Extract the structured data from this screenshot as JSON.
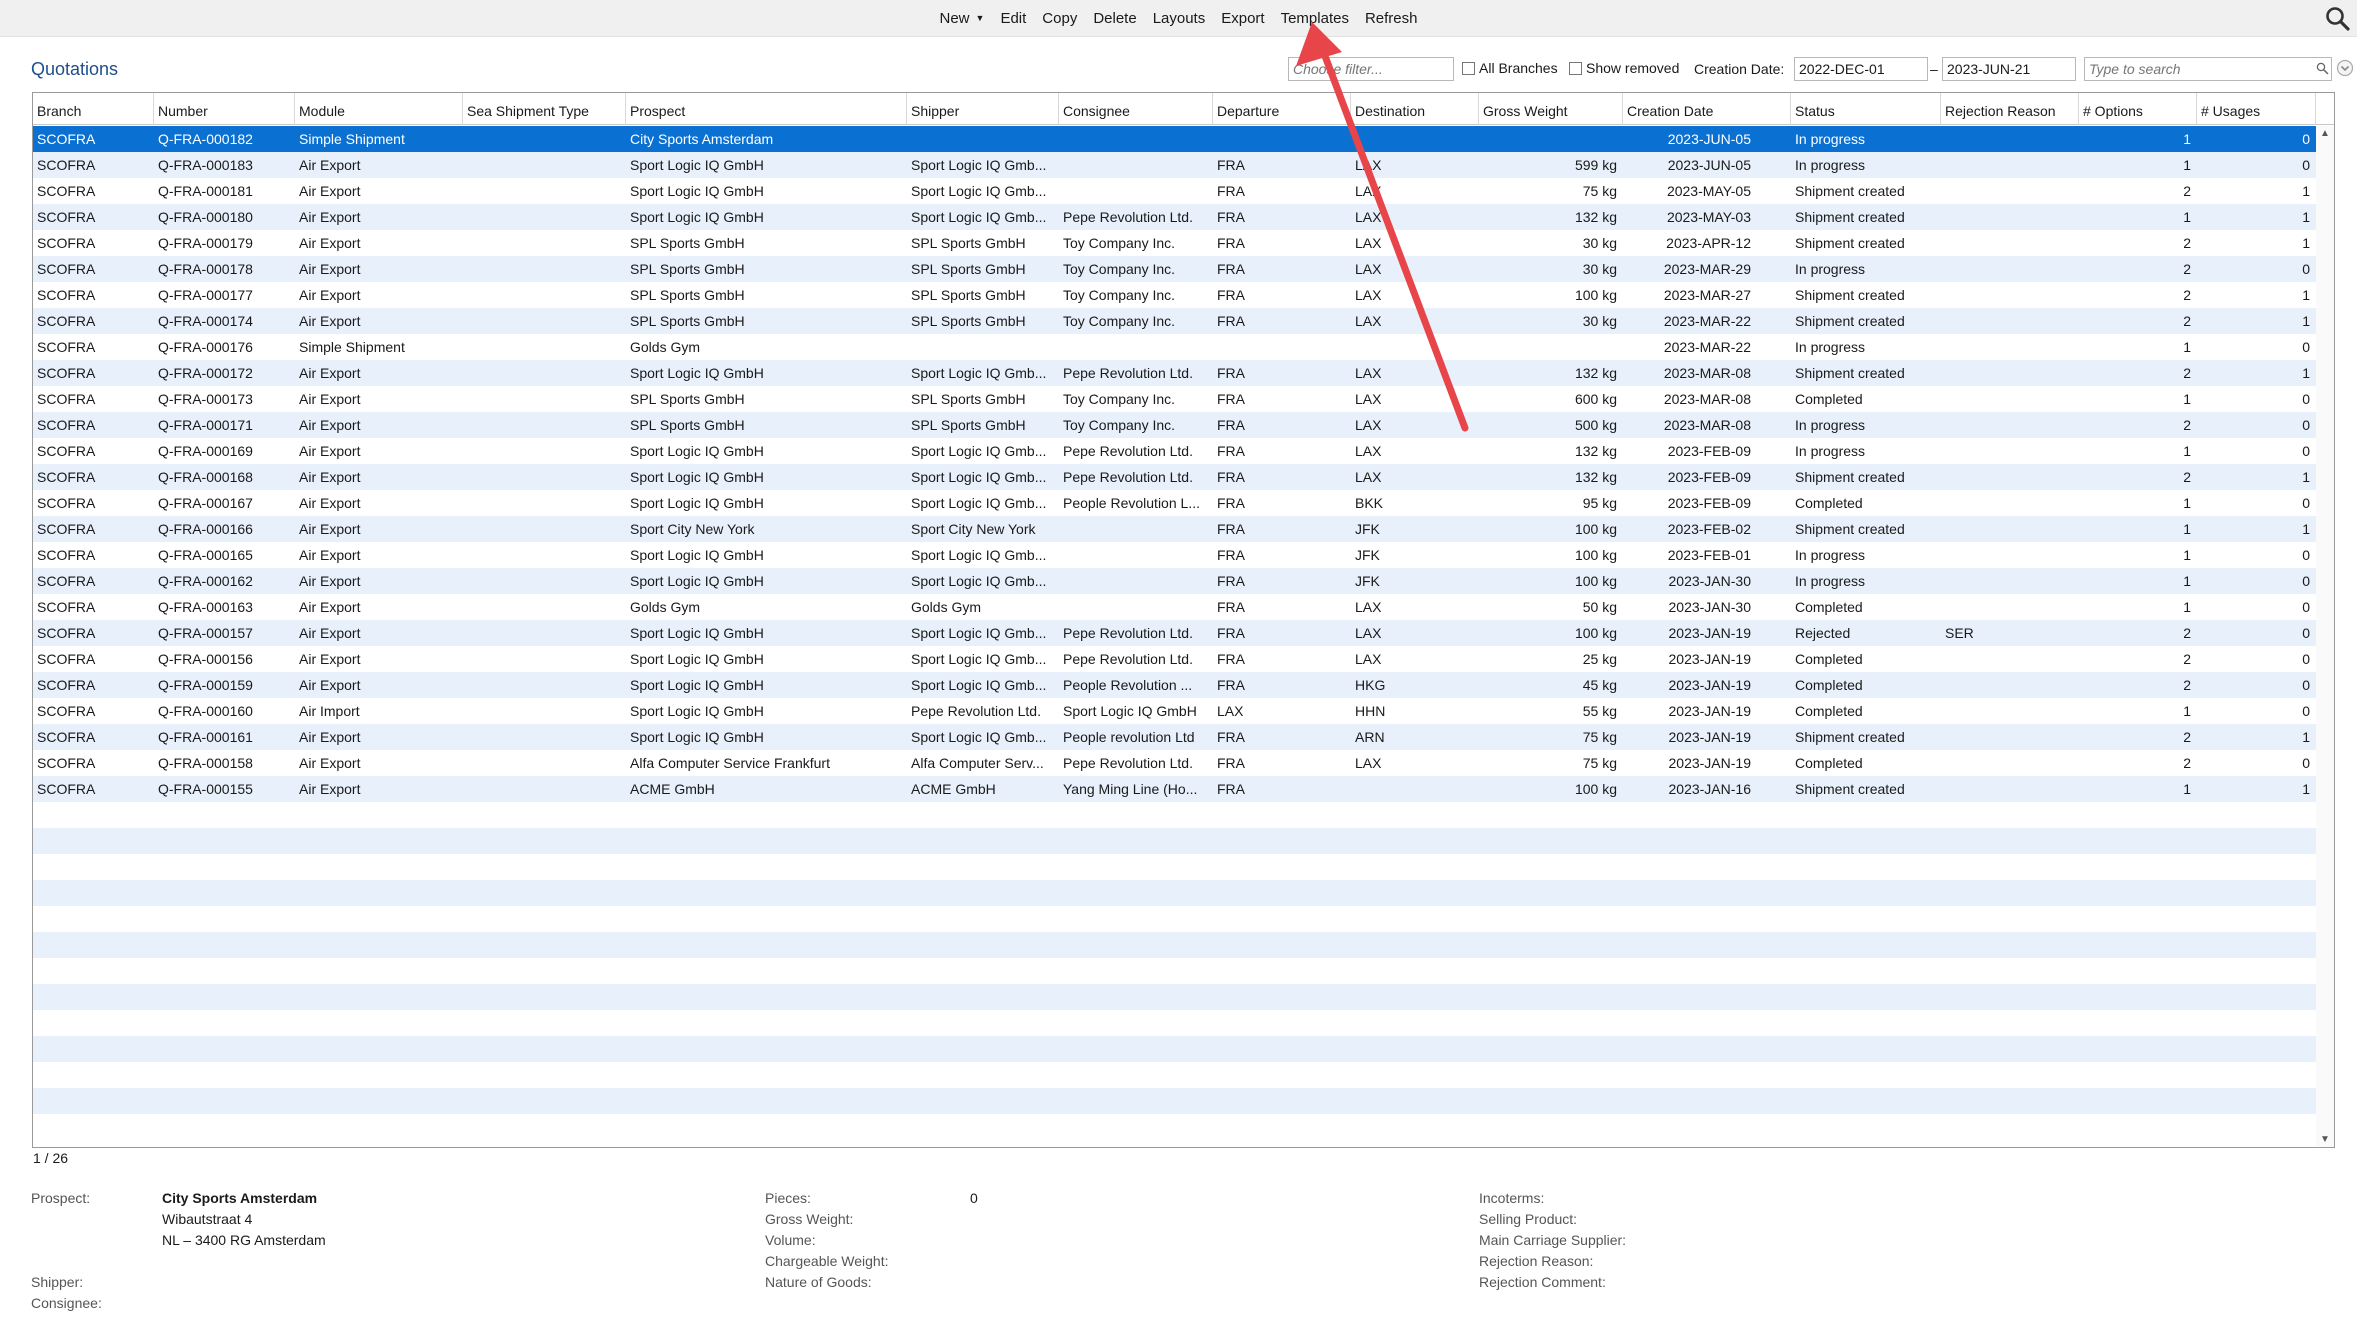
{
  "toolbar": {
    "menu": [
      "New",
      "Edit",
      "Copy",
      "Delete",
      "Layouts",
      "Export",
      "Templates",
      "Refresh"
    ]
  },
  "page": {
    "title": "Quotations",
    "filter_placeholder": "Choose filter...",
    "all_branches_label": "All Branches",
    "show_removed_label": "Show removed",
    "creation_date_label": "Creation Date:",
    "date_from": "2022-DEC-01",
    "date_separator": "–",
    "date_to": "2023-JUN-21",
    "search_placeholder": "Type to search"
  },
  "columns": [
    "Branch",
    "Number",
    "Module",
    "Sea Shipment Type",
    "Prospect",
    "Shipper",
    "Consignee",
    "Departure",
    "Destination",
    "Gross Weight",
    "Creation Date",
    "Status",
    "Rejection Reason",
    "# Options",
    "# Usages"
  ],
  "rows": [
    [
      "SCOFRA",
      "Q-FRA-000182",
      "Simple Shipment",
      "",
      "City Sports Amsterdam",
      "",
      "",
      "",
      "",
      "",
      "2023-JUN-05",
      "In progress",
      "",
      "1",
      "0"
    ],
    [
      "SCOFRA",
      "Q-FRA-000183",
      "Air Export",
      "",
      "Sport Logic IQ GmbH",
      "Sport Logic IQ Gmb...",
      "",
      "FRA",
      "LAX",
      "599 kg",
      "2023-JUN-05",
      "In progress",
      "",
      "1",
      "0"
    ],
    [
      "SCOFRA",
      "Q-FRA-000181",
      "Air Export",
      "",
      "Sport Logic IQ GmbH",
      "Sport Logic IQ Gmb...",
      "",
      "FRA",
      "LAX",
      "75 kg",
      "2023-MAY-05",
      "Shipment created",
      "",
      "2",
      "1"
    ],
    [
      "SCOFRA",
      "Q-FRA-000180",
      "Air Export",
      "",
      "Sport Logic IQ GmbH",
      "Sport Logic IQ Gmb...",
      "Pepe Revolution Ltd.",
      "FRA",
      "LAX",
      "132 kg",
      "2023-MAY-03",
      "Shipment created",
      "",
      "1",
      "1"
    ],
    [
      "SCOFRA",
      "Q-FRA-000179",
      "Air Export",
      "",
      "SPL Sports GmbH",
      "SPL Sports GmbH",
      "Toy Company Inc.",
      "FRA",
      "LAX",
      "30 kg",
      "2023-APR-12",
      "Shipment created",
      "",
      "2",
      "1"
    ],
    [
      "SCOFRA",
      "Q-FRA-000178",
      "Air Export",
      "",
      "SPL Sports GmbH",
      "SPL Sports GmbH",
      "Toy Company Inc.",
      "FRA",
      "LAX",
      "30 kg",
      "2023-MAR-29",
      "In progress",
      "",
      "2",
      "0"
    ],
    [
      "SCOFRA",
      "Q-FRA-000177",
      "Air Export",
      "",
      "SPL Sports GmbH",
      "SPL Sports GmbH",
      "Toy Company Inc.",
      "FRA",
      "LAX",
      "100 kg",
      "2023-MAR-27",
      "Shipment created",
      "",
      "2",
      "1"
    ],
    [
      "SCOFRA",
      "Q-FRA-000174",
      "Air Export",
      "",
      "SPL Sports GmbH",
      "SPL Sports GmbH",
      "Toy Company Inc.",
      "FRA",
      "LAX",
      "30 kg",
      "2023-MAR-22",
      "Shipment created",
      "",
      "2",
      "1"
    ],
    [
      "SCOFRA",
      "Q-FRA-000176",
      "Simple Shipment",
      "",
      "Golds Gym",
      "",
      "",
      "",
      "",
      "",
      "2023-MAR-22",
      "In progress",
      "",
      "1",
      "0"
    ],
    [
      "SCOFRA",
      "Q-FRA-000172",
      "Air Export",
      "",
      "Sport Logic IQ GmbH",
      "Sport Logic IQ Gmb...",
      "Pepe Revolution Ltd.",
      "FRA",
      "LAX",
      "132 kg",
      "2023-MAR-08",
      "Shipment created",
      "",
      "2",
      "1"
    ],
    [
      "SCOFRA",
      "Q-FRA-000173",
      "Air Export",
      "",
      "SPL Sports GmbH",
      "SPL Sports GmbH",
      "Toy Company Inc.",
      "FRA",
      "LAX",
      "600 kg",
      "2023-MAR-08",
      "Completed",
      "",
      "1",
      "0"
    ],
    [
      "SCOFRA",
      "Q-FRA-000171",
      "Air Export",
      "",
      "SPL Sports GmbH",
      "SPL Sports GmbH",
      "Toy Company Inc.",
      "FRA",
      "LAX",
      "500 kg",
      "2023-MAR-08",
      "In progress",
      "",
      "2",
      "0"
    ],
    [
      "SCOFRA",
      "Q-FRA-000169",
      "Air Export",
      "",
      "Sport Logic IQ GmbH",
      "Sport Logic IQ Gmb...",
      "Pepe Revolution Ltd.",
      "FRA",
      "LAX",
      "132 kg",
      "2023-FEB-09",
      "In progress",
      "",
      "1",
      "0"
    ],
    [
      "SCOFRA",
      "Q-FRA-000168",
      "Air Export",
      "",
      "Sport Logic IQ GmbH",
      "Sport Logic IQ Gmb...",
      "Pepe Revolution Ltd.",
      "FRA",
      "LAX",
      "132 kg",
      "2023-FEB-09",
      "Shipment created",
      "",
      "2",
      "1"
    ],
    [
      "SCOFRA",
      "Q-FRA-000167",
      "Air Export",
      "",
      "Sport Logic IQ GmbH",
      "Sport Logic IQ Gmb...",
      "People Revolution L...",
      "FRA",
      "BKK",
      "95 kg",
      "2023-FEB-09",
      "Completed",
      "",
      "1",
      "0"
    ],
    [
      "SCOFRA",
      "Q-FRA-000166",
      "Air Export",
      "",
      "Sport City New York",
      "Sport City New York",
      "",
      "FRA",
      "JFK",
      "100 kg",
      "2023-FEB-02",
      "Shipment created",
      "",
      "1",
      "1"
    ],
    [
      "SCOFRA",
      "Q-FRA-000165",
      "Air Export",
      "",
      "Sport Logic IQ GmbH",
      "Sport Logic IQ Gmb...",
      "",
      "FRA",
      "JFK",
      "100 kg",
      "2023-FEB-01",
      "In progress",
      "",
      "1",
      "0"
    ],
    [
      "SCOFRA",
      "Q-FRA-000162",
      "Air Export",
      "",
      "Sport Logic IQ GmbH",
      "Sport Logic IQ Gmb...",
      "",
      "FRA",
      "JFK",
      "100 kg",
      "2023-JAN-30",
      "In progress",
      "",
      "1",
      "0"
    ],
    [
      "SCOFRA",
      "Q-FRA-000163",
      "Air Export",
      "",
      "Golds Gym",
      "Golds Gym",
      "",
      "FRA",
      "LAX",
      "50 kg",
      "2023-JAN-30",
      "Completed",
      "",
      "1",
      "0"
    ],
    [
      "SCOFRA",
      "Q-FRA-000157",
      "Air Export",
      "",
      "Sport Logic IQ GmbH",
      "Sport Logic IQ Gmb...",
      "Pepe Revolution Ltd.",
      "FRA",
      "LAX",
      "100 kg",
      "2023-JAN-19",
      "Rejected",
      "SER",
      "2",
      "0"
    ],
    [
      "SCOFRA",
      "Q-FRA-000156",
      "Air Export",
      "",
      "Sport Logic IQ GmbH",
      "Sport Logic IQ Gmb...",
      "Pepe Revolution Ltd.",
      "FRA",
      "LAX",
      "25 kg",
      "2023-JAN-19",
      "Completed",
      "",
      "2",
      "0"
    ],
    [
      "SCOFRA",
      "Q-FRA-000159",
      "Air Export",
      "",
      "Sport Logic IQ GmbH",
      "Sport Logic IQ Gmb...",
      "People Revolution ...",
      "FRA",
      "HKG",
      "45 kg",
      "2023-JAN-19",
      "Completed",
      "",
      "2",
      "0"
    ],
    [
      "SCOFRA",
      "Q-FRA-000160",
      "Air Import",
      "",
      "Sport Logic IQ GmbH",
      "Pepe Revolution Ltd.",
      "Sport Logic IQ GmbH",
      "LAX",
      "HHN",
      "55 kg",
      "2023-JAN-19",
      "Completed",
      "",
      "1",
      "0"
    ],
    [
      "SCOFRA",
      "Q-FRA-000161",
      "Air Export",
      "",
      "Sport Logic IQ GmbH",
      "Sport Logic IQ Gmb...",
      "People revolution Ltd",
      "FRA",
      "ARN",
      "75 kg",
      "2023-JAN-19",
      "Shipment created",
      "",
      "2",
      "1"
    ],
    [
      "SCOFRA",
      "Q-FRA-000158",
      "Air Export",
      "",
      "Alfa Computer Service Frankfurt",
      "Alfa Computer Serv...",
      "Pepe Revolution Ltd.",
      "FRA",
      "LAX",
      "75 kg",
      "2023-JAN-19",
      "Completed",
      "",
      "2",
      "0"
    ],
    [
      "SCOFRA",
      "Q-FRA-000155",
      "Air Export",
      "",
      "ACME GmbH",
      "ACME GmbH",
      "Yang Ming Line (Ho...",
      "FRA",
      "",
      "100 kg",
      "2023-JAN-16",
      "Shipment created",
      "",
      "1",
      "1"
    ]
  ],
  "counter": "1 / 26",
  "detail": {
    "prospect_label": "Prospect:",
    "prospect_name": "City Sports Amsterdam",
    "prospect_street": "Wibautstraat 4",
    "prospect_city": "NL – 3400 RG Amsterdam",
    "shipper_label": "Shipper:",
    "consignee_label": "Consignee:",
    "pieces_label": "Pieces:",
    "pieces_value": "0",
    "gross_weight_label": "Gross Weight:",
    "volume_label": "Volume:",
    "chargeable_weight_label": "Chargeable Weight:",
    "nature_of_goods_label": "Nature of Goods:",
    "incoterms_label": "Incoterms:",
    "selling_product_label": "Selling Product:",
    "main_carriage_supplier_label": "Main Carriage Supplier:",
    "rejection_reason_label": "Rejection Reason:",
    "rejection_comment_label": "Rejection Comment:"
  },
  "colors": {
    "selection": "#0a70d1",
    "stripe": "#e8f0fb",
    "title": "#1f4e8c",
    "annotation_arrow": "#e8454a"
  }
}
